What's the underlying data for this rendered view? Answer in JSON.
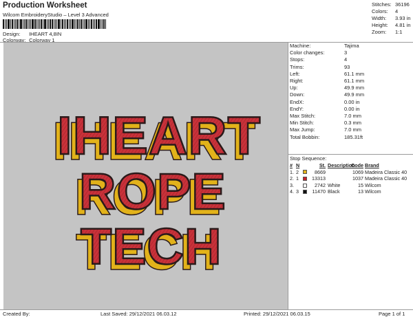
{
  "header": {
    "title": "Production Worksheet",
    "subtitle": "Wilcom EmbroideryStudio – Level 3 Advanced",
    "design_label": "Design:",
    "design_value": "IHEART 4,8IN",
    "colorway_label": "Colorway:",
    "colorway_value": "Colorway 1"
  },
  "summary": [
    {
      "k": "Stitches:",
      "v": "36196"
    },
    {
      "k": "Colors:",
      "v": "4"
    },
    {
      "k": "Width:",
      "v": "3.93 in"
    },
    {
      "k": "Height:",
      "v": "4.81 in"
    },
    {
      "k": "Zoom:",
      "v": "1:1"
    }
  ],
  "design_text": {
    "line1": "IHEART",
    "line2": "ROPE",
    "line3": "TECH"
  },
  "colors": {
    "fill": "#c8323a",
    "shadow": "#e2b21a",
    "outline": "#2a1a1a",
    "canvas": "#c4c4c4"
  },
  "info": [
    {
      "k": "Machine:",
      "v": "Tajima"
    },
    {
      "k": "Color changes:",
      "v": "3"
    },
    {
      "k": "Stops:",
      "v": "4"
    },
    {
      "k": "Trims:",
      "v": "93"
    },
    {
      "k": "Left:",
      "v": "61.1 mm"
    },
    {
      "k": "Right:",
      "v": "61.1 mm"
    },
    {
      "k": "Up:",
      "v": "49.9 mm"
    },
    {
      "k": "Down:",
      "v": "49.9 mm"
    },
    {
      "k": "EndX:",
      "v": "0.00 in"
    },
    {
      "k": "EndY:",
      "v": "0.00 in"
    },
    {
      "k": "Max Stitch:",
      "v": "7.0 mm"
    },
    {
      "k": "Min Stitch:",
      "v": "0.3 mm"
    },
    {
      "k": "Max Jump:",
      "v": "7.0 mm"
    },
    {
      "k": "Total Bobbin:",
      "v": "185.31ft"
    }
  ],
  "stop_sequence": {
    "title": "Stop Sequence:",
    "headers": {
      "num": "#",
      "n": "N",
      "st": "St.",
      "desc": "Description",
      "code": "Code",
      "brand": "Brand"
    },
    "rows": [
      {
        "num": "1.",
        "n": "2",
        "color": "#e2b21a",
        "st": "8669",
        "desc": "",
        "code": "1069",
        "brand": "Madeira Classic 40"
      },
      {
        "num": "2.",
        "n": "1",
        "color": "#c8202a",
        "st": "13313",
        "desc": "",
        "code": "1037",
        "brand": "Madeira Classic 40"
      },
      {
        "num": "3.",
        "n": "",
        "color": "#ffffff",
        "st": "2742",
        "desc": "White",
        "code": "15",
        "brand": "Wilcom"
      },
      {
        "num": "4.",
        "n": "3",
        "color": "#111111",
        "st": "11470",
        "desc": "Black",
        "code": "13",
        "brand": "Wilcom"
      }
    ]
  },
  "footer": {
    "created": "Created By:",
    "saved": "Last Saved: 29/12/2021 06.03.12",
    "printed": "Printed: 29/12/2021 06.03.15",
    "page": "Page 1 of 1"
  }
}
